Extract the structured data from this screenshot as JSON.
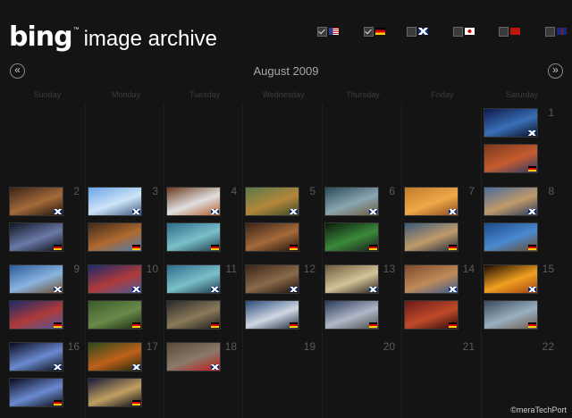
{
  "header": {
    "logo_word": "bing",
    "logo_tm": "™",
    "subtitle": "image archive"
  },
  "filters": [
    {
      "market": "en-US",
      "checked": true,
      "flag": "us-flag"
    },
    {
      "market": "de-DE",
      "checked": true,
      "flag": "de-flag"
    },
    {
      "market": "en-GB",
      "checked": false,
      "flag": "uk-flag"
    },
    {
      "market": "ja-JP",
      "checked": false,
      "flag": "jp-flag"
    },
    {
      "market": "zh-CN",
      "checked": false,
      "flag": "cn-flag"
    },
    {
      "market": "en-AU",
      "checked": false,
      "flag": "au-flag"
    }
  ],
  "calendar": {
    "month_label": "August 2009",
    "prev_icon": "«",
    "next_icon": "»",
    "weekdays": [
      "Sunday",
      "Monday",
      "Tuesday",
      "Wednesday",
      "Thursday",
      "Friday",
      "Saturday"
    ],
    "days": [
      {
        "n": "1",
        "images": [
          {
            "region": "uk",
            "colors": [
              "#0e1a4a",
              "#3a6fb8",
              "#0a0f22"
            ]
          },
          {
            "region": "de",
            "colors": [
              "#7a3a1c",
              "#c65b2e",
              "#2b3b6a"
            ]
          }
        ]
      },
      {
        "n": "2",
        "images": [
          {
            "region": "uk",
            "colors": [
              "#3a2418",
              "#a46a3a",
              "#1e120a"
            ]
          },
          {
            "region": "de",
            "colors": [
              "#101522",
              "#6a7aa8",
              "#0a0c14"
            ]
          }
        ]
      },
      {
        "n": "3",
        "images": [
          {
            "region": "uk",
            "colors": [
              "#6aa4e6",
              "#cde4f8",
              "#3a5a80"
            ]
          },
          {
            "region": "de",
            "colors": [
              "#3c2a18",
              "#b06a30",
              "#4a7ab0"
            ]
          }
        ]
      },
      {
        "n": "4",
        "images": [
          {
            "region": "uk",
            "colors": [
              "#6a3a1e",
              "#e0e0e0",
              "#b25a2a"
            ]
          },
          {
            "region": "de",
            "colors": [
              "#2f6a8c",
              "#7ac0c8",
              "#1c3a4a"
            ]
          }
        ]
      },
      {
        "n": "5",
        "images": [
          {
            "region": "uk",
            "colors": [
              "#5a7a4a",
              "#b4863a",
              "#3a4a2a"
            ]
          },
          {
            "region": "de",
            "colors": [
              "#3a2418",
              "#a46a3a",
              "#1e120a"
            ]
          }
        ]
      },
      {
        "n": "6",
        "images": [
          {
            "region": "uk",
            "colors": [
              "#2a4a5a",
              "#8aa6b0",
              "#6a5a3a"
            ]
          },
          {
            "region": "de",
            "colors": [
              "#0c1a0c",
              "#3a8a3a",
              "#1a1a1a"
            ]
          }
        ]
      },
      {
        "n": "7",
        "images": [
          {
            "region": "uk",
            "colors": [
              "#c07a2a",
              "#f0a848",
              "#8a4a1a"
            ]
          },
          {
            "region": "de",
            "colors": [
              "#3a5a7a",
              "#c09a6a",
              "#1c2a3a"
            ]
          }
        ]
      },
      {
        "n": "8",
        "images": [
          {
            "region": "uk",
            "colors": [
              "#4a6a9a",
              "#c09a6a",
              "#2a3a5a"
            ]
          },
          {
            "region": "de",
            "colors": [
              "#1c4a8a",
              "#4a8ad0",
              "#6a4a2a"
            ]
          }
        ]
      },
      {
        "n": "9",
        "images": [
          {
            "region": "uk",
            "colors": [
              "#2a5a9a",
              "#8ab4e0",
              "#6a4a2a"
            ]
          },
          {
            "region": "de",
            "colors": [
              "#1a2a6a",
              "#b03a3a",
              "#4a5a9a"
            ]
          }
        ]
      },
      {
        "n": "10",
        "images": [
          {
            "region": "uk",
            "colors": [
              "#1a2a6a",
              "#b03a3a",
              "#4a5a9a"
            ]
          },
          {
            "region": "de",
            "colors": [
              "#3a5a2a",
              "#6a8a4a",
              "#1c2a12"
            ]
          }
        ]
      },
      {
        "n": "11",
        "images": [
          {
            "region": "uk",
            "colors": [
              "#2f6a8c",
              "#7ac0c8",
              "#1c3a4a"
            ]
          },
          {
            "region": "de",
            "colors": [
              "#2a2a2a",
              "#8a7a5a",
              "#1a1a1a"
            ]
          }
        ]
      },
      {
        "n": "12",
        "images": [
          {
            "region": "uk",
            "colors": [
              "#3a2418",
              "#8a6a4a",
              "#1a1008"
            ]
          },
          {
            "region": "de",
            "colors": [
              "#2a4a7a",
              "#d0d8e4",
              "#1a2a3a"
            ]
          }
        ]
      },
      {
        "n": "13",
        "images": [
          {
            "region": "uk",
            "colors": [
              "#6a5a3a",
              "#d4c49a",
              "#2a2418"
            ]
          },
          {
            "region": "de",
            "colors": [
              "#2a3a5a",
              "#b0b8c8",
              "#4a4a4a"
            ]
          }
        ]
      },
      {
        "n": "14",
        "images": [
          {
            "region": "uk",
            "colors": [
              "#7a4a2a",
              "#c08a5a",
              "#3a5a8a"
            ]
          },
          {
            "region": "de",
            "colors": [
              "#6a1a1a",
              "#c04a2a",
              "#2a0a0a"
            ]
          }
        ]
      },
      {
        "n": "15",
        "images": [
          {
            "region": "uk",
            "colors": [
              "#1a0a04",
              "#f0a020",
              "#a04010"
            ]
          },
          {
            "region": "de",
            "colors": [
              "#3a4a5a",
              "#9ab0c0",
              "#6a5a4a"
            ]
          }
        ]
      },
      {
        "n": "16",
        "images": [
          {
            "region": "uk",
            "colors": [
              "#0a0a1e",
              "#6a8ad0",
              "#0a0a10"
            ]
          },
          {
            "region": "de",
            "colors": [
              "#0a0a1e",
              "#6a8ad0",
              "#0a0a10"
            ]
          }
        ]
      },
      {
        "n": "17",
        "images": [
          {
            "region": "uk",
            "colors": [
              "#2a4a1a",
              "#c0601a",
              "#1a2a0a"
            ]
          },
          {
            "region": "de",
            "colors": [
              "#1a1a3a",
              "#c0a060",
              "#0a0a1a"
            ]
          }
        ]
      },
      {
        "n": "18",
        "images": [
          {
            "region": "uk",
            "colors": [
              "#5a4a3a",
              "#8a7a6a",
              "#c01a1a"
            ]
          }
        ]
      },
      {
        "n": "19",
        "images": []
      },
      {
        "n": "20",
        "images": []
      },
      {
        "n": "21",
        "images": []
      },
      {
        "n": "22",
        "images": []
      }
    ]
  },
  "watermark": "©meraTechPort"
}
